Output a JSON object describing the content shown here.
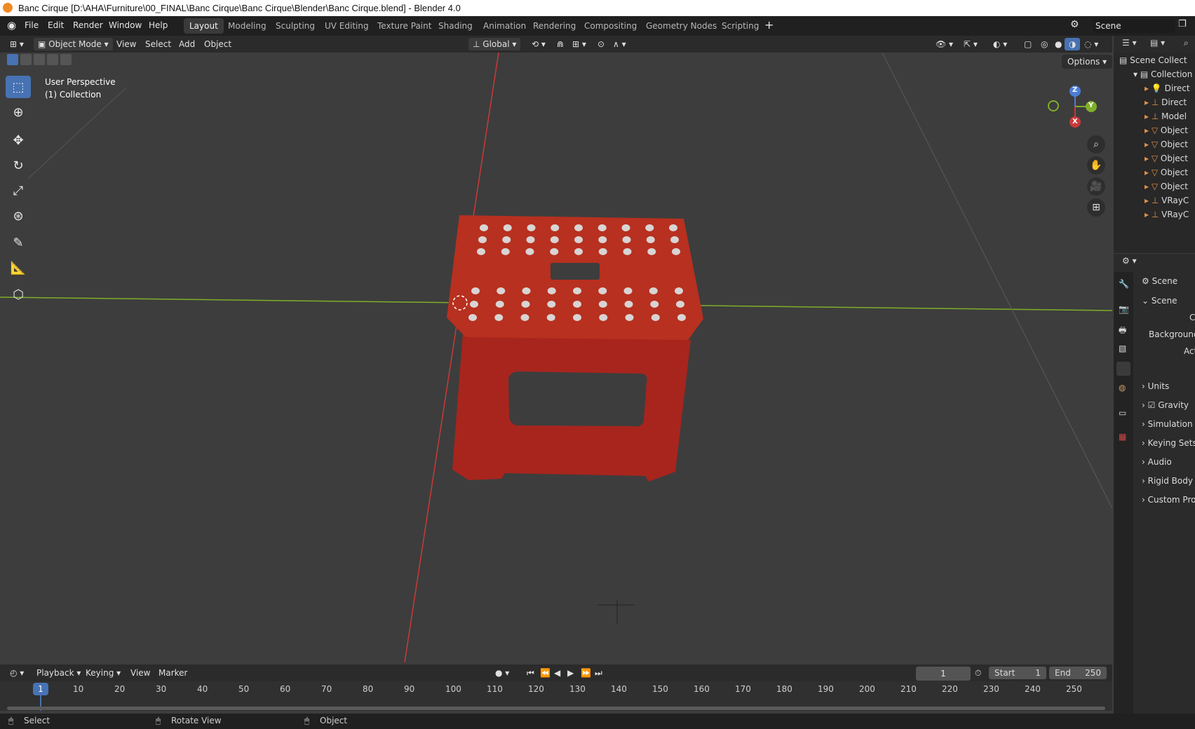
{
  "window": {
    "title": "Banc Cirque [D:\\AHA\\Furniture\\00_FINAL\\Banc Cirque\\Banc Cirque\\Blender\\Banc Cirque.blend] - Blender 4.0"
  },
  "menu": {
    "file": "File",
    "edit": "Edit",
    "render": "Render",
    "window": "Window",
    "help": "Help"
  },
  "workspaces": [
    "Layout",
    "Modeling",
    "Sculpting",
    "UV Editing",
    "Texture Paint",
    "Shading",
    "Animation",
    "Rendering",
    "Compositing",
    "Geometry Nodes",
    "Scripting"
  ],
  "scene_selector": {
    "label": "Scene"
  },
  "header3d": {
    "mode": "Object Mode",
    "view": "View",
    "select": "Select",
    "add": "Add",
    "object": "Object",
    "orientation": "Global"
  },
  "viewport": {
    "perspective": "User Perspective",
    "collection": "(1) Collection",
    "options": "Options"
  },
  "gizmo": {
    "z": "Z",
    "y": "Y",
    "x": "X"
  },
  "outliner": {
    "scene_collection": "Scene Collect",
    "collection": "Collection",
    "items": [
      "Direct",
      "Direct",
      "Model",
      "Object",
      "Object",
      "Object",
      "Object",
      "Object",
      "VRayC",
      "VRayC"
    ]
  },
  "properties": {
    "context": "Scene",
    "panel_title": "Scene",
    "camera_label": "C",
    "background_label": "Background",
    "active_label": "Activ",
    "panels": [
      "Units",
      "Gravity",
      "Simulation",
      "Keying Sets",
      "Audio",
      "Rigid Body",
      "Custom Pro"
    ]
  },
  "timeline": {
    "playback": "Playback",
    "keying": "Keying",
    "view": "View",
    "marker": "Marker",
    "current_frame": "1",
    "start_label": "Start",
    "start": "1",
    "end_label": "End",
    "end": "250",
    "ticks": [
      "10",
      "20",
      "30",
      "40",
      "50",
      "60",
      "70",
      "80",
      "90",
      "100",
      "110",
      "120",
      "130",
      "140",
      "150",
      "160",
      "170",
      "180",
      "190",
      "200",
      "210",
      "220",
      "230",
      "240",
      "250"
    ],
    "cursor": "1"
  },
  "statusbar": {
    "select": "Select",
    "rotate": "Rotate View",
    "object": "Object"
  },
  "colors": {
    "accent": "#4772b3",
    "stool_red": "#b3271f",
    "x_axis": "#c93a3a",
    "y_axis": "#7fae2a"
  }
}
